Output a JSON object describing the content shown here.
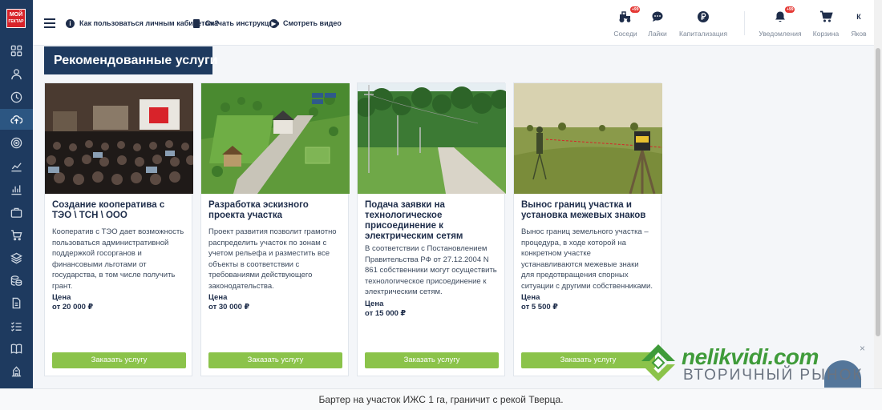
{
  "logo": {
    "line1": "МОЙ",
    "line2": "ГЕКТАР"
  },
  "sidebar": {
    "items": [
      {
        "icon": "grid-icon"
      },
      {
        "icon": "user-icon"
      },
      {
        "icon": "clock-icon"
      },
      {
        "icon": "cloud-upload-icon",
        "active": true
      },
      {
        "icon": "target-icon"
      },
      {
        "icon": "trend-icon"
      },
      {
        "icon": "bar-chart-icon"
      },
      {
        "icon": "briefcase-icon"
      },
      {
        "icon": "cart-icon"
      },
      {
        "icon": "layers-icon"
      },
      {
        "icon": "coins-icon"
      },
      {
        "icon": "document-icon"
      },
      {
        "icon": "checklist-icon"
      },
      {
        "icon": "book-icon"
      },
      {
        "icon": "building-icon"
      }
    ]
  },
  "header": {
    "help_link": "Как пользоваться личным кабинетом?",
    "download_link": "Скачать инструкцию",
    "video_link": "Смотреть видео",
    "tools": [
      {
        "label": "Соседи",
        "badge": "+99",
        "icon": "tractor-icon"
      },
      {
        "label": "Лайки",
        "icon": "chat-icon"
      },
      {
        "label": "Капитализация",
        "icon": "ruble-icon"
      },
      {
        "label": "Уведомления",
        "badge": "+99",
        "icon": "bell-icon"
      },
      {
        "label": "Корзина",
        "icon": "cart-icon"
      },
      {
        "label": "Яков",
        "avatar": "К"
      }
    ]
  },
  "section": {
    "title": "Рекомендованные услуги"
  },
  "cards": [
    {
      "title": "Создание кооператива с ТЭО \\ ТСН \\ ООО",
      "text": "Кооператив с ТЭО дает возможность пользоваться административной поддержкой госорганов и финансовыми льготами от государства, в том числе получить грант.",
      "price_label": "Цена",
      "price": "от 20 000 ₽",
      "button": "Заказать услугу",
      "image": "conference-hall"
    },
    {
      "title": "Разработка эскизного проекта участка",
      "text": "Проект развития позволит грамотно распределить участок по зонам с учетом рельефа и разместить все объекты в соответствии с требованиями действующего законодательства.",
      "price_label": "Цена",
      "price": "от 30 000 ₽",
      "button": "Заказать услугу",
      "image": "site-plan-render"
    },
    {
      "title": "Подача заявки на технологическое присоединение к электрическим сетям",
      "text": "В соответствии с Постановлением Правительства РФ от 27.12.2004 N 861 собственники могут осуществить технологическое присоединение к электрическим сетям.",
      "price_label": "Цена",
      "price": "от 15 000 ₽",
      "button": "Заказать услугу",
      "image": "power-line-road"
    },
    {
      "title": "Вынос границ участка и установка межевых знаков",
      "text": "Вынос границ земельного участка – процедура, в ходе которой на конкретном участке устанавливаются межевые знаки для предотвращения спорных ситуации с другими собственниками.",
      "price_label": "Цена",
      "price": "от 5 500 ₽",
      "button": "Заказать услугу",
      "image": "surveyor-field"
    }
  ],
  "watermark": {
    "name": "nelikvidi.com",
    "subtitle": "ВТОРИЧНЫЙ РЫНОК",
    "close": "×"
  },
  "ticker": {
    "text": "Бартер на участок ИЖС 1 га, граничит с рекой Тверца."
  },
  "colors": {
    "sidebar": "#1e3a5f",
    "accent_green": "#8bc34a",
    "badge_red": "#e53935"
  }
}
